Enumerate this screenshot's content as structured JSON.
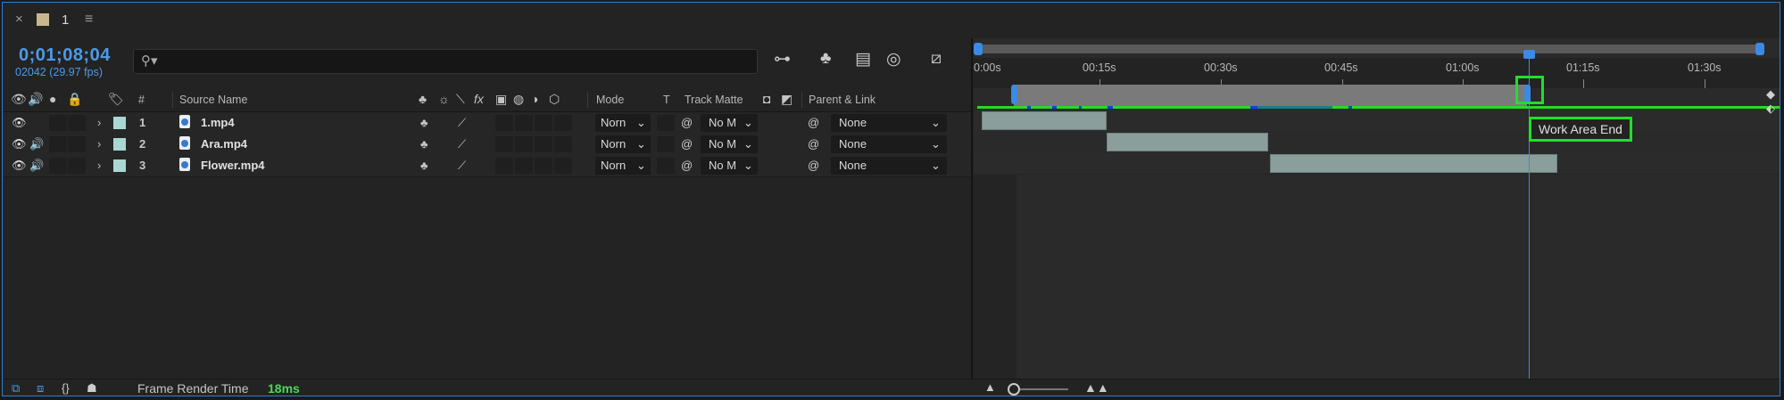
{
  "tab": {
    "close": "×",
    "name": "1",
    "menu": "≡"
  },
  "time": {
    "timecode": "0;01;08;04",
    "fps": "02042 (29.97 fps)"
  },
  "search": {
    "placeholder": "",
    "icon": "search-icon"
  },
  "columns": {
    "num": "#",
    "source_name": "Source Name",
    "mode": "Mode",
    "t": "T",
    "track_matte": "Track Matte",
    "parent_link": "Parent & Link",
    "fx": "fx"
  },
  "layers": [
    {
      "num": "1",
      "name": "1.mp4",
      "mode": "Norn",
      "matte": "No M",
      "parent": "None",
      "has_audio": false
    },
    {
      "num": "2",
      "name": "Ara.mp4",
      "mode": "Norn",
      "matte": "No M",
      "parent": "None",
      "has_audio": true
    },
    {
      "num": "3",
      "name": "Flower.mp4",
      "mode": "Norn",
      "matte": "No M",
      "parent": "None",
      "has_audio": true
    }
  ],
  "ruler": {
    "labels": [
      "0:00s",
      "00:15s",
      "00:30s",
      "00:45s",
      "01:00s",
      "01:15s",
      "01:30s"
    ]
  },
  "tooltip": "Work Area End",
  "footer": {
    "frame_render_label": "Frame Render Time",
    "frame_render_value": "18ms"
  },
  "colors": {
    "accent": "#3a8ae6",
    "highlight": "#1fe02a",
    "label": "#a9d8d3",
    "clip": "#8a9e9b"
  }
}
